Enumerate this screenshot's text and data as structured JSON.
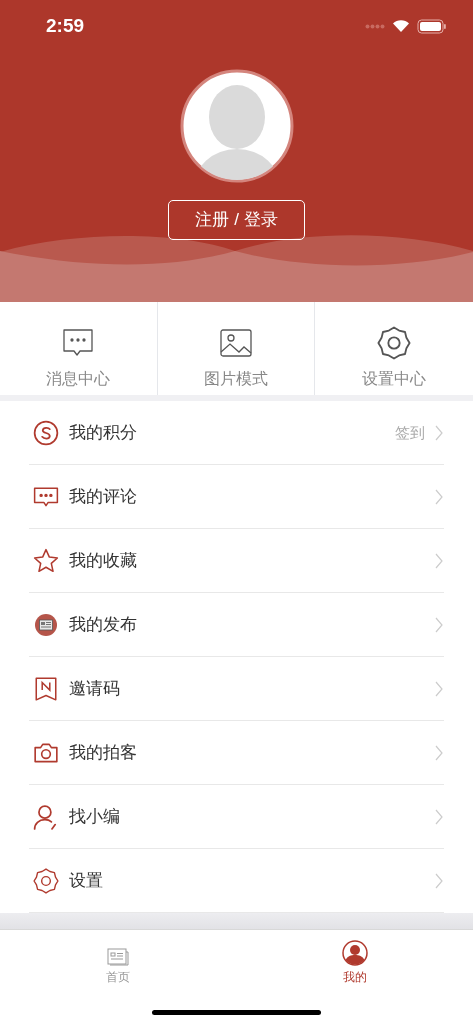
{
  "status_bar": {
    "time": "2:59"
  },
  "header": {
    "login_button": "注册 / 登录"
  },
  "quick_actions": [
    {
      "kind": "messages",
      "label": "消息中心"
    },
    {
      "kind": "pictures",
      "label": "图片模式"
    },
    {
      "kind": "settings",
      "label": "设置中心"
    }
  ],
  "menu": [
    {
      "kind": "points",
      "label": "我的积分",
      "hint": "签到"
    },
    {
      "kind": "comments",
      "label": "我的评论"
    },
    {
      "kind": "favorites",
      "label": "我的收藏"
    },
    {
      "kind": "posts",
      "label": "我的发布"
    },
    {
      "kind": "invite",
      "label": "邀请码"
    },
    {
      "kind": "camera",
      "label": "我的拍客"
    },
    {
      "kind": "editor",
      "label": "找小编"
    },
    {
      "kind": "settings",
      "label": "设置"
    }
  ],
  "tab_bar": [
    {
      "kind": "home",
      "label": "首页",
      "selected": false
    },
    {
      "kind": "profile",
      "label": "我的",
      "selected": true
    }
  ]
}
